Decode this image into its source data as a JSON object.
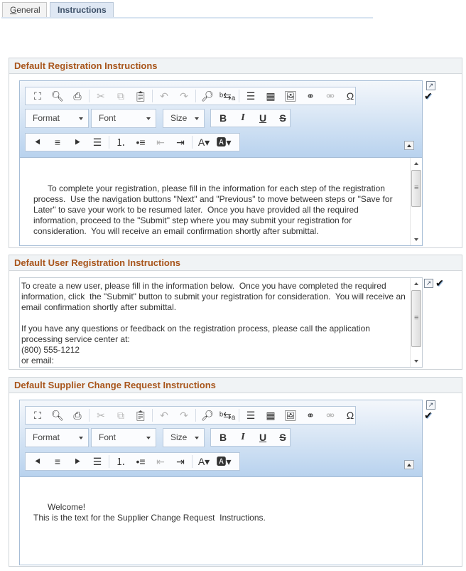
{
  "tabs": [
    {
      "label_underlined": "G",
      "label_rest": "eneral",
      "active": false
    },
    {
      "label": "Instructions",
      "active": true
    }
  ],
  "toolbar": {
    "row1": [
      {
        "icon": "maximize-icon",
        "glyph": "⛶",
        "enabled": true
      },
      {
        "icon": "preview-icon",
        "glyph": "🔍︎",
        "enabled": true
      },
      {
        "icon": "print-icon",
        "glyph": "⎙",
        "enabled": true
      },
      {
        "sep": true
      },
      {
        "icon": "cut-icon",
        "glyph": "✂",
        "enabled": false
      },
      {
        "icon": "copy-icon",
        "glyph": "⧉",
        "enabled": false
      },
      {
        "icon": "paste-icon",
        "glyph": "📋︎",
        "enabled": true
      },
      {
        "sep": true
      },
      {
        "icon": "undo-icon",
        "glyph": "↶",
        "enabled": false
      },
      {
        "icon": "redo-icon",
        "glyph": "↷",
        "enabled": false
      },
      {
        "sep": true
      },
      {
        "icon": "find-icon",
        "glyph": "🔎︎",
        "enabled": true
      },
      {
        "icon": "replace-icon",
        "glyph": "ᵇ⇆ₐ",
        "enabled": true
      },
      {
        "sep": true
      },
      {
        "icon": "horizontal-rule-icon",
        "glyph": "☰",
        "enabled": true
      },
      {
        "icon": "table-icon",
        "glyph": "▦",
        "enabled": true
      },
      {
        "icon": "image-icon",
        "glyph": "🖼︎",
        "enabled": true
      },
      {
        "icon": "link-icon",
        "glyph": "⚭",
        "enabled": true
      },
      {
        "icon": "unlink-icon",
        "glyph": "⚮",
        "enabled": false
      },
      {
        "icon": "special-char-icon",
        "glyph": "Ω",
        "enabled": true
      }
    ],
    "format_label": "Format",
    "font_label": "Font",
    "size_label": "Size",
    "bius": [
      {
        "icon": "bold-icon",
        "glyph": "B"
      },
      {
        "icon": "italic-icon",
        "glyph": "I"
      },
      {
        "icon": "underline-icon",
        "glyph": "U"
      },
      {
        "icon": "strikethrough-icon",
        "glyph": "S"
      }
    ],
    "row3": [
      {
        "icon": "align-left-icon",
        "glyph": "⯇",
        "enabled": true
      },
      {
        "icon": "align-center-icon",
        "glyph": "≡",
        "enabled": true
      },
      {
        "icon": "align-right-icon",
        "glyph": "⯈",
        "enabled": true
      },
      {
        "icon": "justify-icon",
        "glyph": "☰",
        "enabled": true
      },
      {
        "sep": true
      },
      {
        "icon": "numbered-list-icon",
        "glyph": "⒈",
        "enabled": true
      },
      {
        "icon": "bulleted-list-icon",
        "glyph": "•≡",
        "enabled": true
      },
      {
        "icon": "outdent-icon",
        "glyph": "⇤",
        "enabled": false
      },
      {
        "icon": "indent-icon",
        "glyph": "⇥",
        "enabled": true
      },
      {
        "sep": true
      },
      {
        "icon": "text-color-icon",
        "glyph": "A▾",
        "enabled": true
      },
      {
        "icon": "background-color-icon",
        "glyph": "🅰▾",
        "enabled": true
      }
    ]
  },
  "sections": [
    {
      "title": "Default Registration Instructions",
      "content": "To complete your registration, please fill in the information for each step of the registration process.  Use the navigation buttons \"Next\" and \"Previous\" to move between steps or \"Save for Later\" to save your work to be resumed later.  Once you have provided all the required information, proceed to the \"Submit\" step where you may submit your registration for consideration.  You will receive an email confirmation shortly after submittal.\n\nIf you have any questions or feedback on the registration process, please call the application"
    },
    {
      "title": "Default User Registration Instructions",
      "content": "To create a new user, please fill in the information below.  Once you have completed the required information, click  the \"Submit\" button to submit your registration for consideration.  You will receive an email confirmation shortly after submittal.\n\nIf you have any questions or feedback on the registration process, please call the application processing service center at:\n(800) 555-1212\nor email:"
    },
    {
      "title": "Default Supplier Change Request Instructions",
      "content": "Welcome!\nThis is the text for the Supplier Change Request  Instructions."
    }
  ],
  "icons": {
    "expand_glyph": "↗",
    "spellcheck_glyph": "✔"
  }
}
